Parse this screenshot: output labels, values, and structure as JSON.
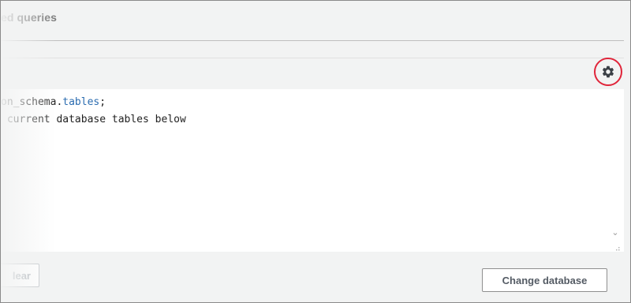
{
  "tabs": {
    "saved_queries_label": "ed queries"
  },
  "toolbar": {
    "settings_icon": "gear-icon",
    "highlight_color": "#e0253a"
  },
  "editor": {
    "line1_prefix": "on_schema.",
    "line1_keyword": "tables",
    "line1_suffix": ";",
    "line2": " current database tables below"
  },
  "footer": {
    "clear_label": "lear",
    "change_database_label": "Change database"
  }
}
